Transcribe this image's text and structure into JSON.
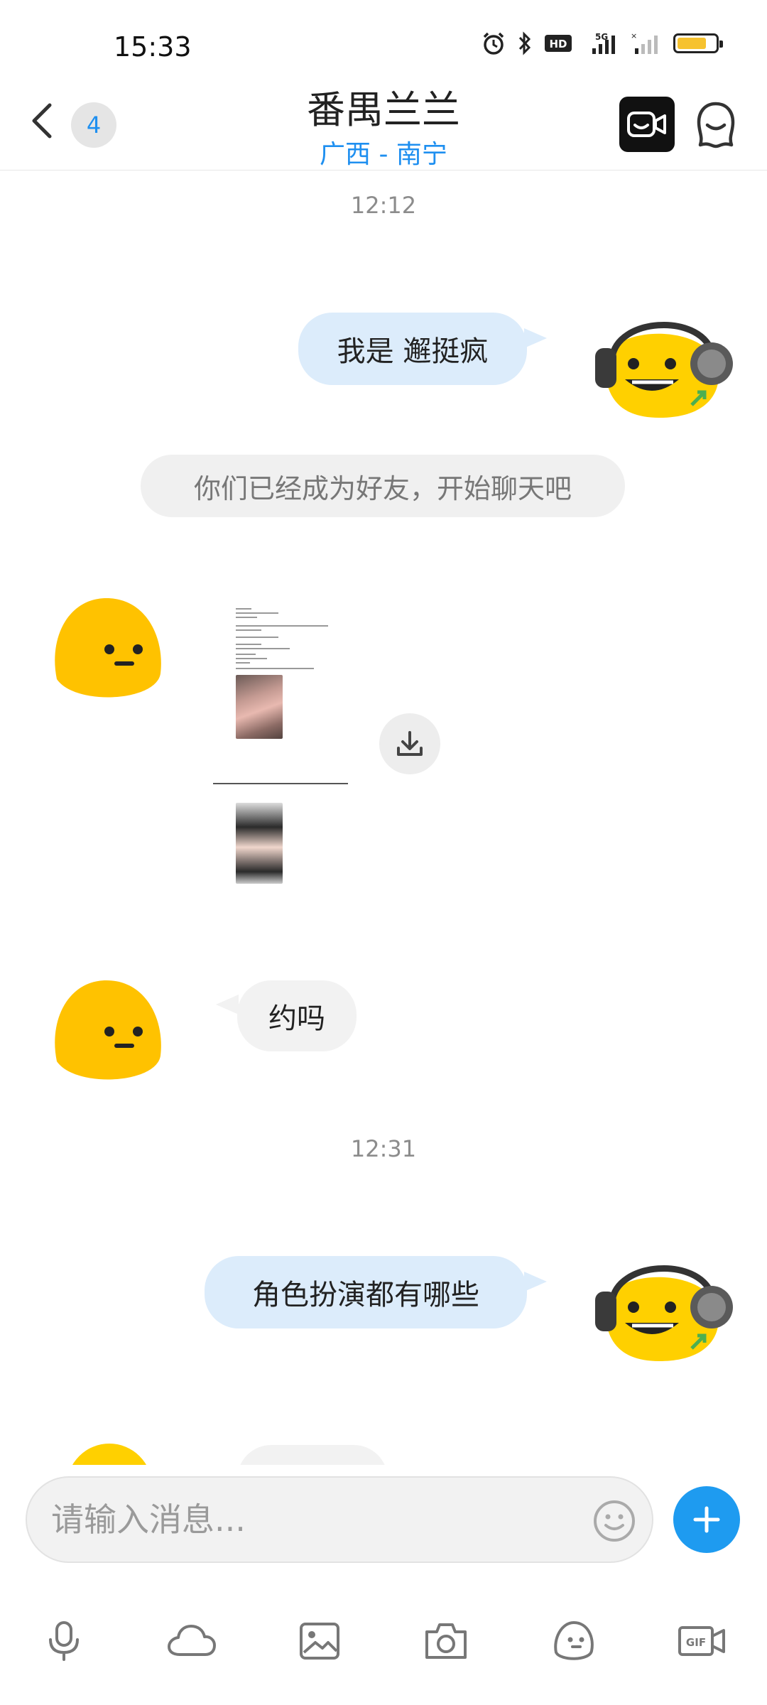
{
  "status_bar": {
    "time": "15:33",
    "network_label": "5G"
  },
  "header": {
    "back_icon": "chevron-left-icon",
    "unread_count": "4",
    "title": "番禺兰兰",
    "subtitle": "广西 - 南宁",
    "video_call_icon": "video-call-icon",
    "profile_icon": "profile-icon"
  },
  "messages": [
    {
      "type": "timestamp",
      "text": "12:12"
    },
    {
      "type": "sent",
      "text": "我是 邂挺疯"
    },
    {
      "type": "system",
      "text": "你们已经成为好友，开始聊天吧"
    },
    {
      "type": "received_file",
      "icon": "download-icon"
    },
    {
      "type": "received",
      "text": "约吗"
    },
    {
      "type": "timestamp",
      "text": "12:31"
    },
    {
      "type": "sent",
      "text": "角色扮演都有哪些"
    }
  ],
  "input": {
    "placeholder": "请输入消息..."
  },
  "toolbar": [
    "microphone-icon",
    "cloud-icon",
    "image-icon",
    "camera-icon",
    "sticker-icon",
    "gif-icon"
  ],
  "colors": {
    "accent": "#1e9bf0",
    "sent_bubble": "#dcecfb",
    "received_bubble": "#f2f2f2",
    "avatar_yellow": "#ffd000"
  }
}
